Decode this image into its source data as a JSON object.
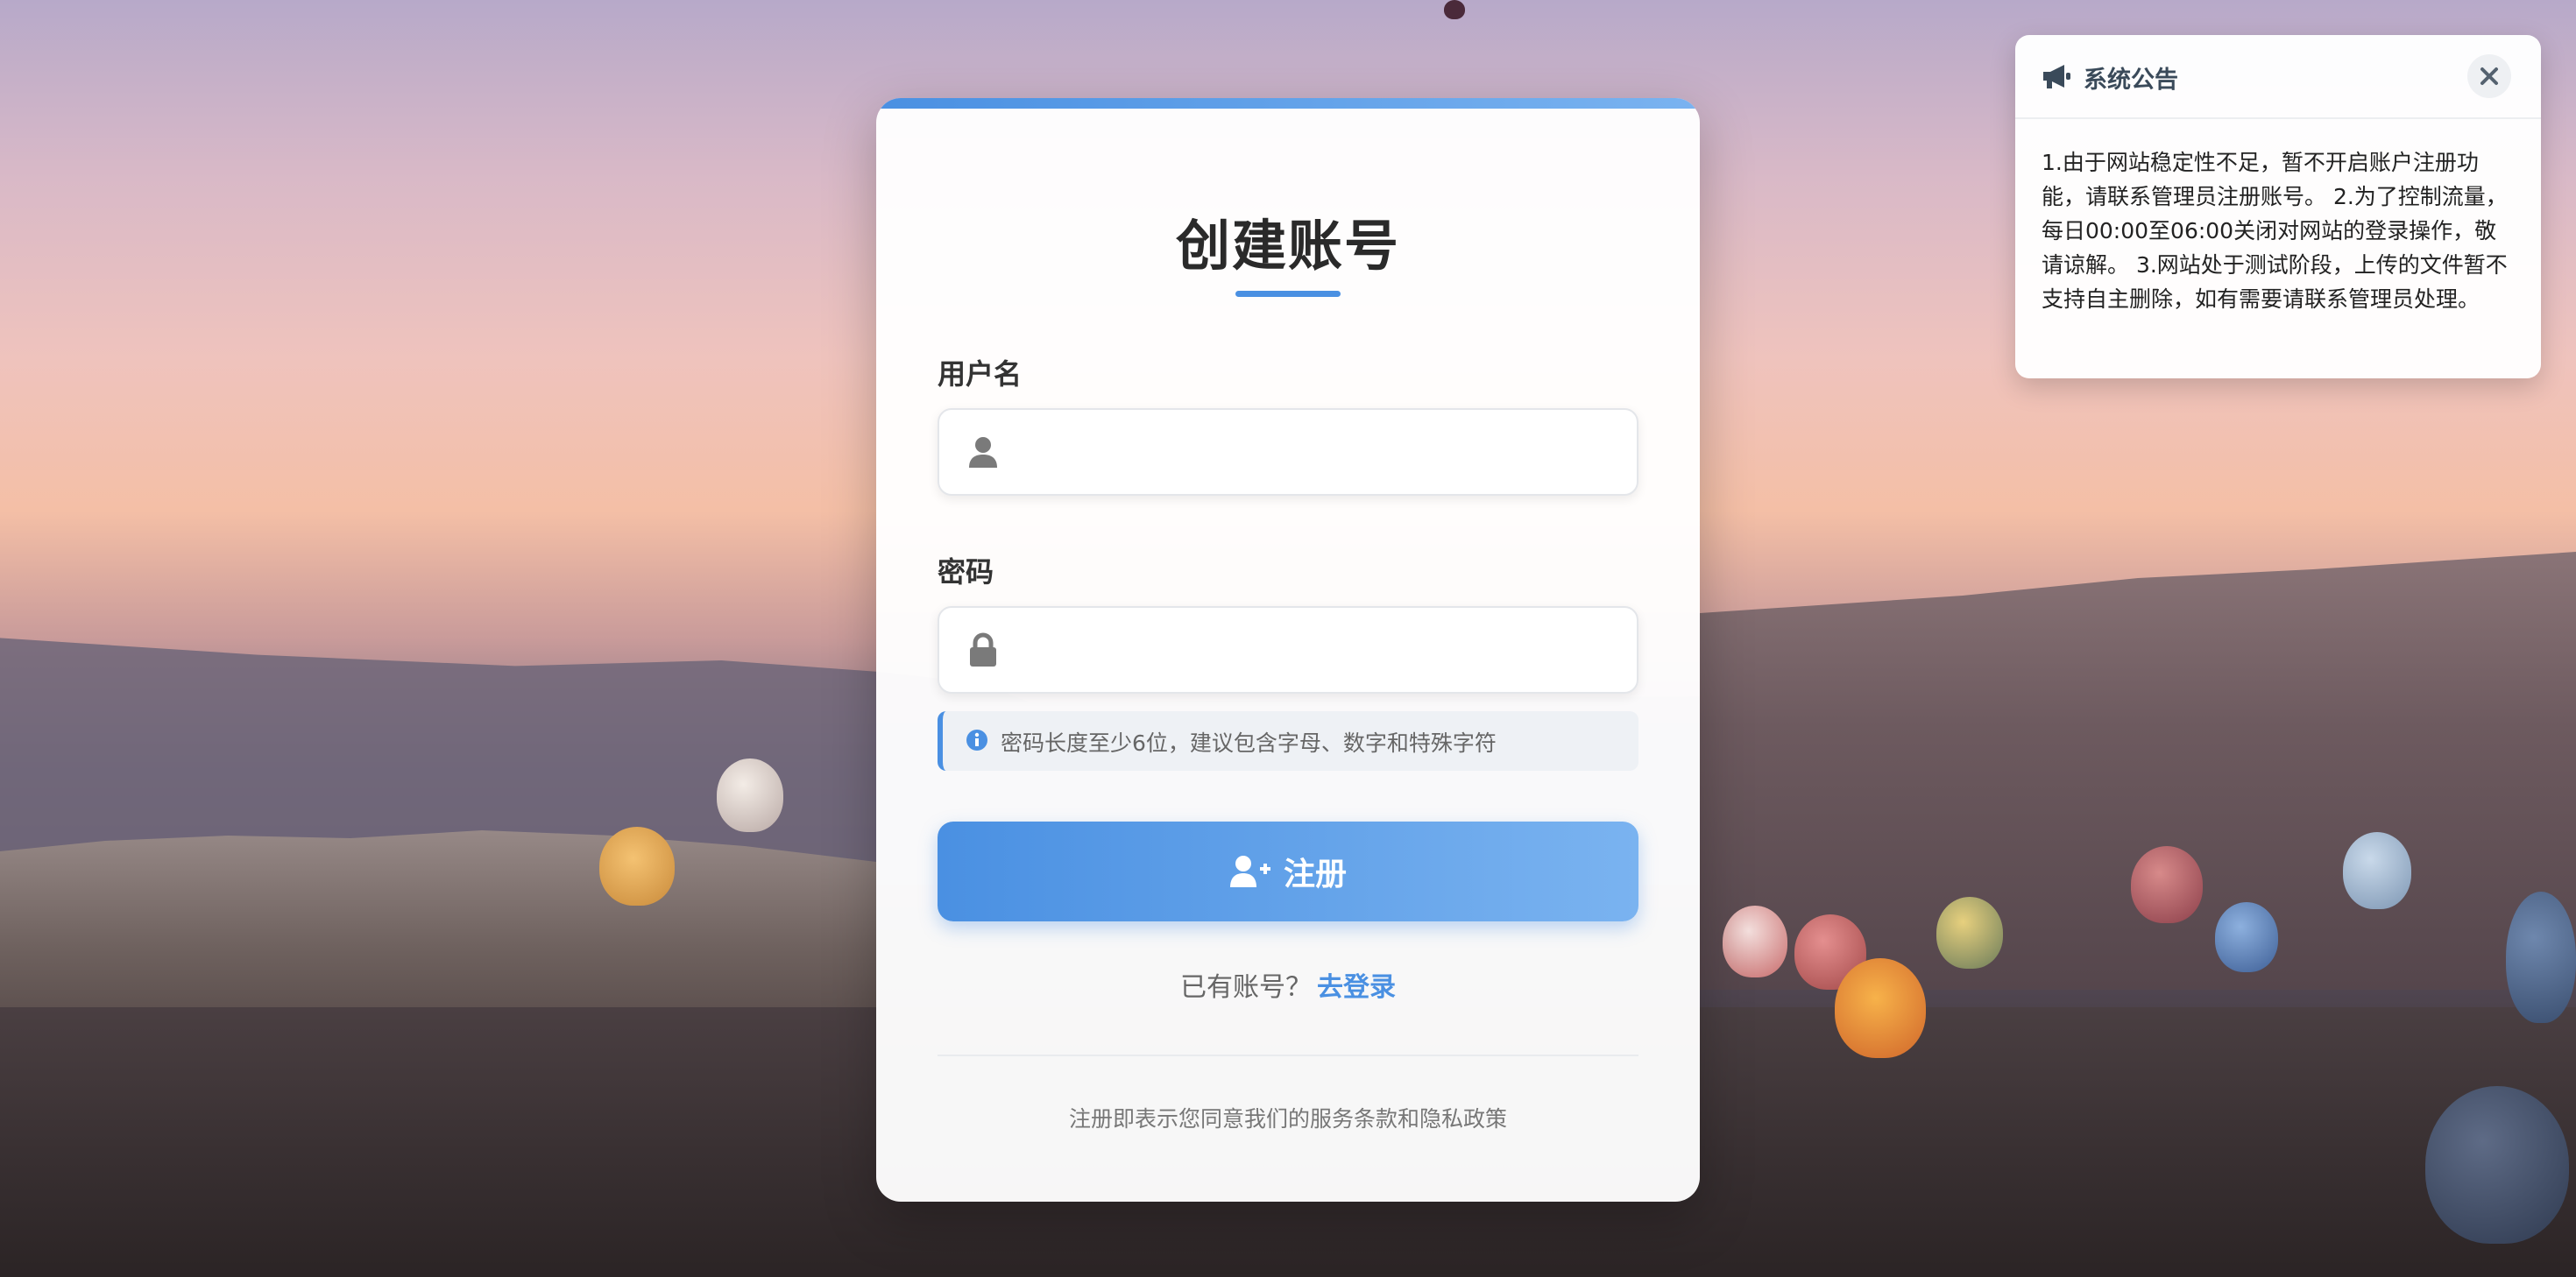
{
  "register": {
    "title": "创建账号",
    "username_label": "用户名",
    "username_value": "",
    "password_label": "密码",
    "password_value": "",
    "password_hint": "密码长度至少6位，建议包含字母、数字和特殊字符",
    "submit_label": "注册",
    "has_account_text": "已有账号？",
    "login_link": "去登录",
    "terms_text": "注册即表示您同意我们的服务条款和隐私政策",
    "icons": {
      "username": "user-icon",
      "password": "lock-icon",
      "hint": "info-icon",
      "submit": "user-plus-icon"
    },
    "accent_color": "#4a90e2"
  },
  "notice": {
    "title": "系统公告",
    "icon": "megaphone-icon",
    "close_icon": "close-icon",
    "body": "1.由于网站稳定性不足，暂不开启账户注册功能，请联系管理员注册账号。 2.为了控制流量，每日00:00至06:00关闭对网站的登录操作，敬请谅解。 3.网站处于测试阶段，上传的文件暂不支持自主删除，如有需要请联系管理员处理。"
  }
}
